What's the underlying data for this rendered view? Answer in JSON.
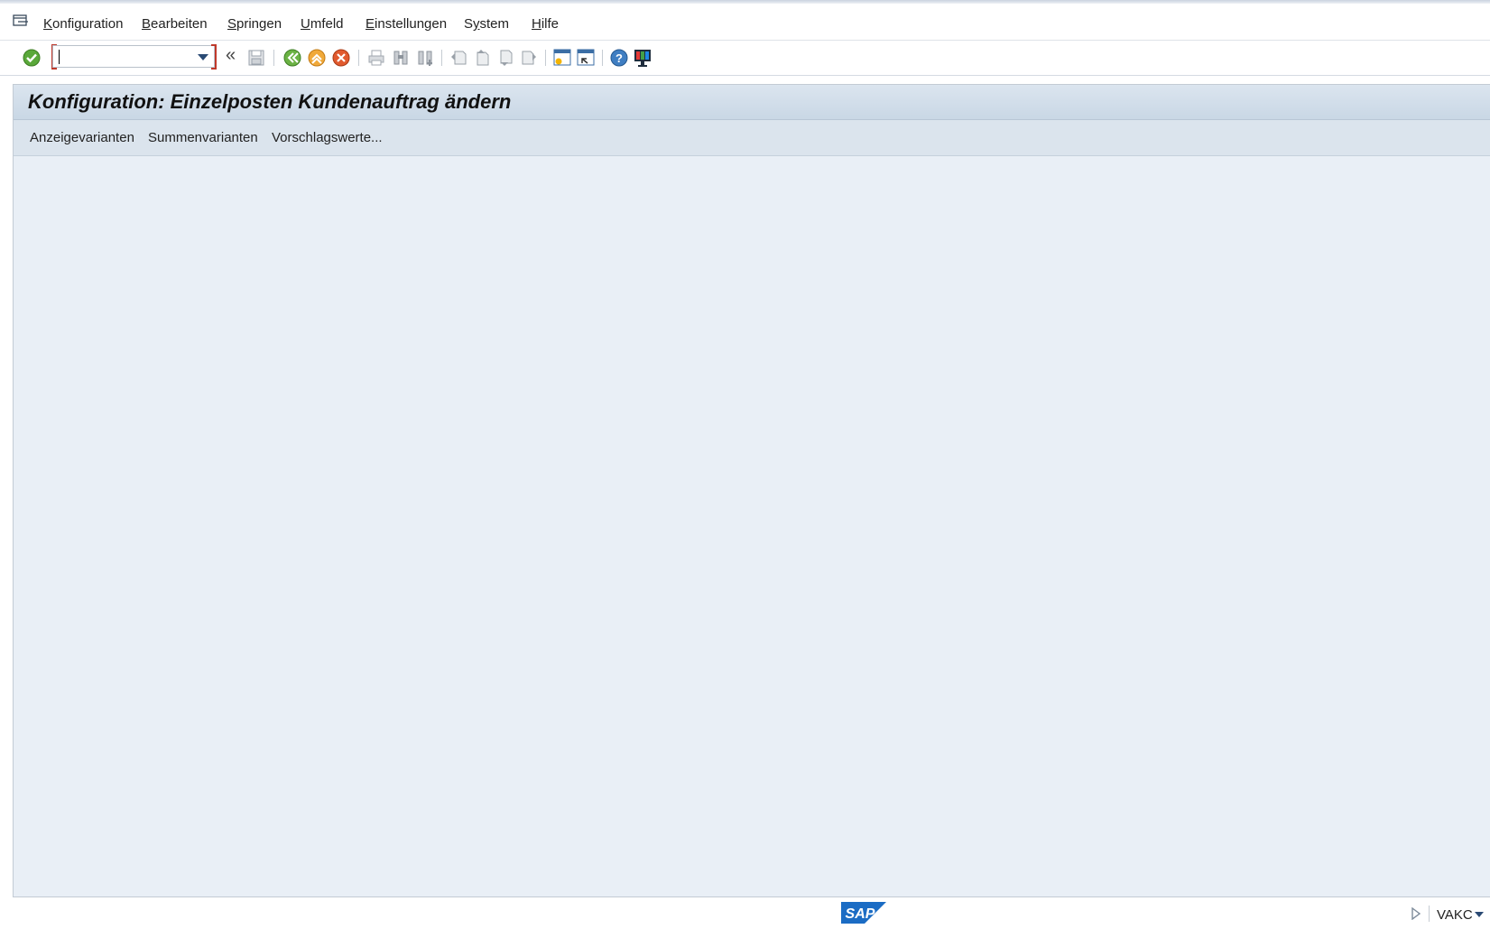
{
  "menu": {
    "items": [
      {
        "label": "Konfiguration",
        "mnemonic": "K",
        "rest": "onfiguration"
      },
      {
        "label": "Bearbeiten",
        "mnemonic": "B",
        "rest": "earbeiten"
      },
      {
        "label": "Springen",
        "mnemonic": "S",
        "rest": "pringen"
      },
      {
        "label": "Umfeld",
        "mnemonic": "U",
        "rest": "mfeld"
      },
      {
        "label": "Einstellungen",
        "mnemonic": "E",
        "rest": "instellungen"
      },
      {
        "label": "System",
        "mnemonic": "y",
        "pre": "S",
        "rest": "stem"
      },
      {
        "label": "Hilfe",
        "mnemonic": "H",
        "rest": "ilfe"
      }
    ]
  },
  "toolbar": {
    "command_field_value": "",
    "collapse_glyph": "«",
    "icons": [
      "enter-icon",
      "save-icon",
      "back-icon",
      "exit-icon",
      "cancel-icon",
      "print-icon",
      "find-icon",
      "find-next-icon",
      "first-page-icon",
      "previous-page-icon",
      "next-page-icon",
      "last-page-icon",
      "create-session-icon",
      "generate-shortcut-icon",
      "help-icon",
      "layout-menu-icon"
    ]
  },
  "screen": {
    "title": "Konfiguration: Einzelposten Kundenauftrag ändern",
    "app_buttons": [
      "Anzeigevarianten",
      "Summenvarianten",
      "Vorschlagswerte..."
    ]
  },
  "status": {
    "logo_text": "SAP",
    "system": "VAKC"
  },
  "colors": {
    "title_bg": "#c9d7e5",
    "panel_bg": "#e9eff6",
    "appbar_bg": "#dbe4ed",
    "sap_blue": "#1b6cc4"
  }
}
